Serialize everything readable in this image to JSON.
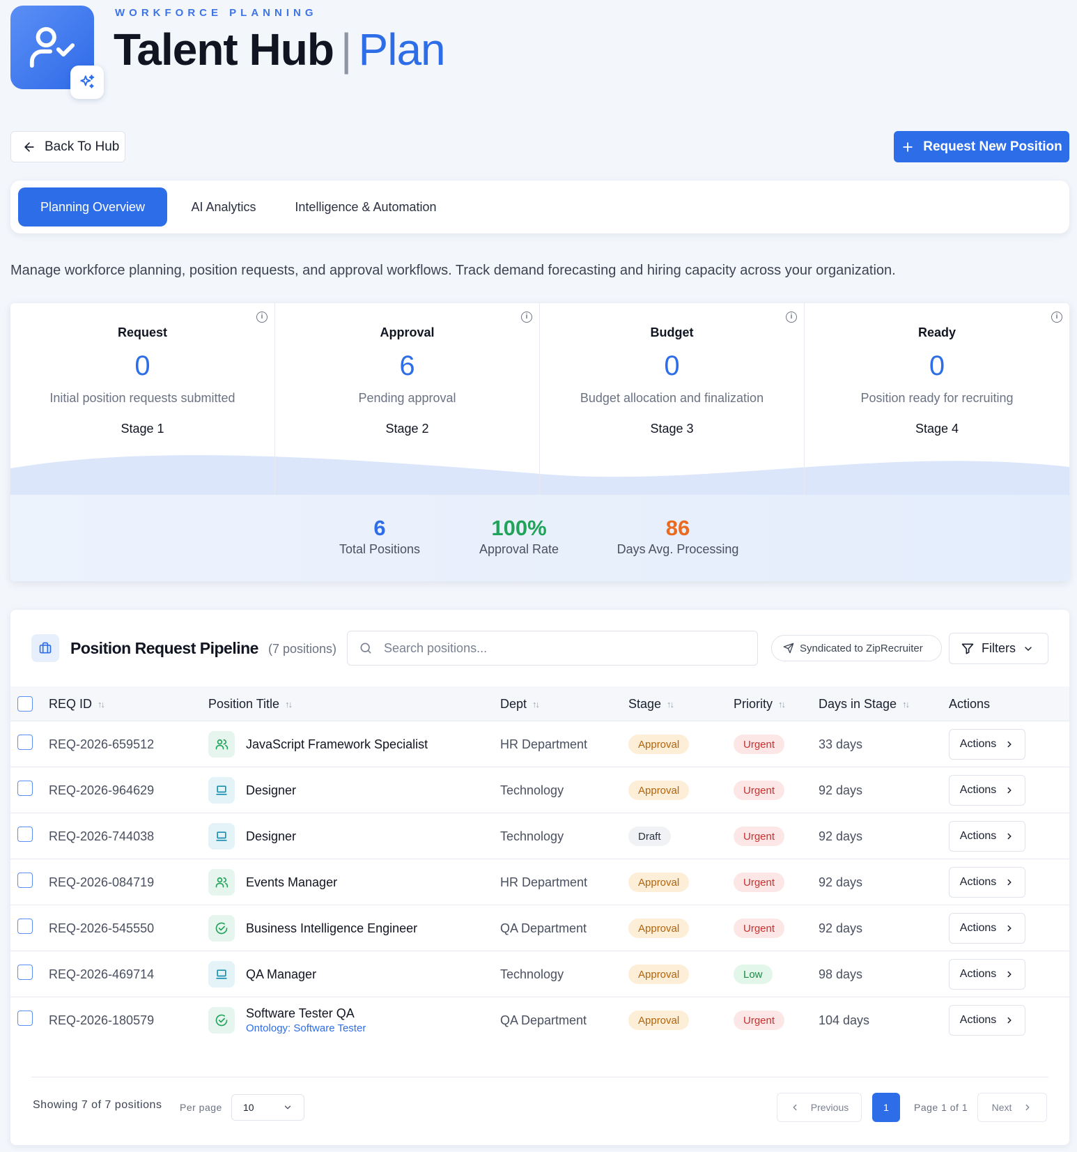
{
  "header": {
    "eyebrow": "WORKFORCE PLANNING",
    "title": "Talent Hub",
    "separator": "|",
    "title_accent": "Plan"
  },
  "nav": {
    "back_label": "Back To Hub",
    "request_label": "Request New Position"
  },
  "tabs": [
    {
      "label": "Planning Overview",
      "active": true
    },
    {
      "label": "AI Analytics",
      "active": false
    },
    {
      "label": "Intelligence & Automation",
      "active": false
    }
  ],
  "description": "Manage workforce planning, position requests, and approval workflows. Track demand forecasting and hiring capacity across your organization.",
  "stages": [
    {
      "name": "Request",
      "count": "0",
      "desc": "Initial position requests submitted",
      "step": "Stage 1"
    },
    {
      "name": "Approval",
      "count": "6",
      "desc": "Pending approval",
      "step": "Stage 2"
    },
    {
      "name": "Budget",
      "count": "0",
      "desc": "Budget allocation and finalization",
      "step": "Stage 3"
    },
    {
      "name": "Ready",
      "count": "0",
      "desc": "Position ready for recruiting",
      "step": "Stage 4"
    }
  ],
  "summary": [
    {
      "value": "6",
      "label": "Total Positions",
      "color": "#2d6ee8"
    },
    {
      "value": "100%",
      "label": "Approval Rate",
      "color": "#22a35a"
    },
    {
      "value": "86",
      "label": "Days Avg. Processing",
      "color": "#ea6a1f"
    }
  ],
  "pipeline": {
    "title": "Position Request Pipeline",
    "count": "(7 positions)",
    "search_placeholder": "Search positions...",
    "syndicated_label": "Syndicated to ZipRecruiter",
    "filters_label": "Filters",
    "columns": {
      "req_id": "REQ ID",
      "title": "Position Title",
      "dept": "Dept",
      "stage": "Stage",
      "priority": "Priority",
      "days": "Days in Stage",
      "actions": "Actions"
    },
    "rows": [
      {
        "id": "REQ-2026-659512",
        "title": "JavaScript Framework Specialist",
        "icon": "users-icon",
        "dept": "HR Department",
        "stage": "Approval",
        "priority": "Urgent",
        "days": "33 days",
        "action": "Actions"
      },
      {
        "id": "REQ-2026-964629",
        "title": "Designer",
        "icon": "laptop-icon",
        "dept": "Technology",
        "stage": "Approval",
        "priority": "Urgent",
        "days": "92 days",
        "action": "Actions"
      },
      {
        "id": "REQ-2026-744038",
        "title": "Designer",
        "icon": "laptop-icon",
        "dept": "Technology",
        "stage": "Draft",
        "priority": "Urgent",
        "days": "92 days",
        "action": "Actions"
      },
      {
        "id": "REQ-2026-084719",
        "title": "Events Manager",
        "icon": "users-icon",
        "dept": "HR Department",
        "stage": "Approval",
        "priority": "Urgent",
        "days": "92 days",
        "action": "Actions"
      },
      {
        "id": "REQ-2026-545550",
        "title": "Business Intelligence Engineer",
        "icon": "check-circle-icon",
        "dept": "QA Department",
        "stage": "Approval",
        "priority": "Urgent",
        "days": "92 days",
        "action": "Actions"
      },
      {
        "id": "REQ-2026-469714",
        "title": "QA Manager",
        "icon": "laptop-icon",
        "dept": "Technology",
        "stage": "Approval",
        "priority": "Low",
        "days": "98 days",
        "action": "Actions"
      },
      {
        "id": "REQ-2026-180579",
        "title": "Software Tester QA",
        "subtitle": "Ontology: Software Tester",
        "icon": "check-circle-icon",
        "dept": "QA Department",
        "stage": "Approval",
        "priority": "Urgent",
        "days": "104 days",
        "action": "Actions"
      }
    ]
  },
  "footer": {
    "showing": "Showing 7 of 7 positions",
    "per_page_label": "Per page",
    "per_page_value": "10",
    "previous": "Previous",
    "page_number": "1",
    "page_info": "Page 1 of 1",
    "next": "Next"
  },
  "colors": {
    "accent": "#2d6ee8",
    "approval_pill": "#fdeed8",
    "urgent_pill": "#fde6e6",
    "low_pill": "#e2f6e9"
  }
}
